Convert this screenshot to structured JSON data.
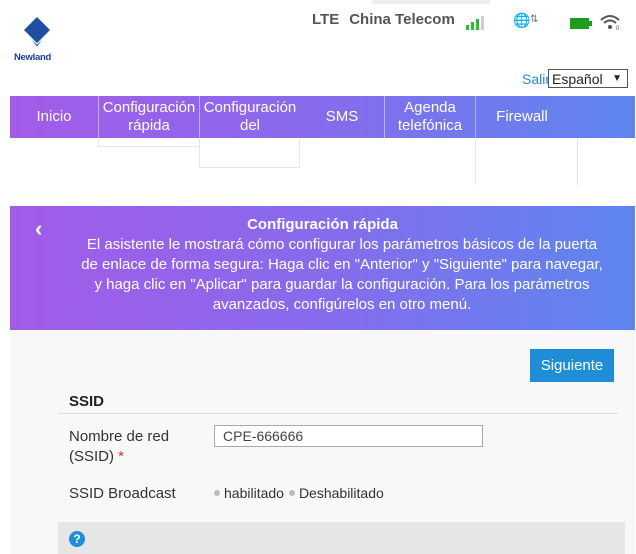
{
  "header": {
    "logo_text": "Newland",
    "network_type": "LTE",
    "carrier": "China Telecom",
    "logout_label": "Salir",
    "language": "Español"
  },
  "nav": {
    "items": [
      {
        "label": "Inicio"
      },
      {
        "label": "Configuración rápida"
      },
      {
        "label": "Configuración del"
      },
      {
        "label": "SMS"
      },
      {
        "label": "Agenda telefónica"
      },
      {
        "label": "Firewall"
      }
    ]
  },
  "wizard": {
    "title": "Configuración rápida",
    "description": "El asistente le mostrará cómo configurar los parámetros básicos de la puerta de enlace de forma segura: Haga clic en \"Anterior\" y \"Siguiente\" para navegar, y haga clic en \"Aplicar\" para guardar la configuración. Para los parámetros avanzados, configúrelos en otro menú.",
    "next_label": "Siguiente",
    "section_title": "SSID",
    "network_name_label": "Nombre de red (SSID)",
    "required_mark": "*",
    "ssid_value": "CPE-666666",
    "broadcast_label": "SSID Broadcast",
    "broadcast_enabled": "habilitado",
    "broadcast_disabled": "Deshabilitado"
  },
  "colors": {
    "accent_blue": "#1f8ed6",
    "nav_gradient_start": "#a35be8",
    "nav_gradient_end": "#5d86ef",
    "signal_green": "#2bc02b"
  }
}
